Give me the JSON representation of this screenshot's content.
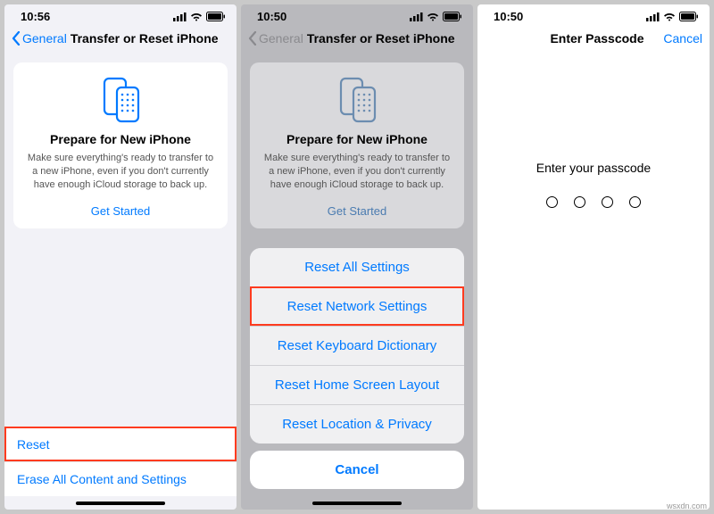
{
  "screen1": {
    "status_time": "10:56",
    "nav_back": "General",
    "nav_title": "Transfer or Reset iPhone",
    "card_title": "Prepare for New iPhone",
    "card_body": "Make sure everything's ready to transfer to a new iPhone, even if you don't currently have enough iCloud storage to back up.",
    "card_link": "Get Started",
    "rows": {
      "reset": "Reset",
      "erase": "Erase All Content and Settings"
    }
  },
  "screen2": {
    "status_time": "10:50",
    "nav_back": "General",
    "nav_title": "Transfer or Reset iPhone",
    "card_title": "Prepare for New iPhone",
    "card_body": "Make sure everything's ready to transfer to a new iPhone, even if you don't currently have enough iCloud storage to back up.",
    "card_link": "Get Started",
    "sheet": {
      "opt1": "Reset All Settings",
      "opt2": "Reset Network Settings",
      "opt3": "Reset Keyboard Dictionary",
      "opt4": "Reset Home Screen Layout",
      "opt5": "Reset Location & Privacy",
      "cancel": "Cancel"
    }
  },
  "screen3": {
    "status_time": "10:50",
    "nav_title": "Enter Passcode",
    "nav_cancel": "Cancel",
    "prompt": "Enter your passcode"
  },
  "watermark": "wsxdn.com"
}
